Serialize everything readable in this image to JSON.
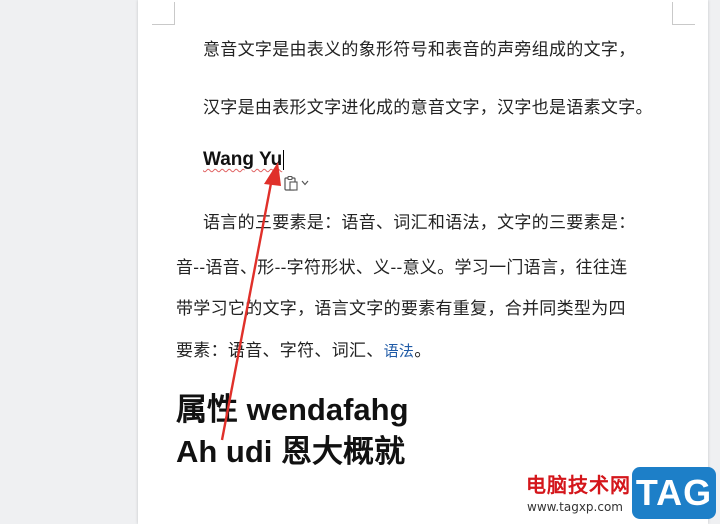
{
  "document": {
    "line1": "意音文字是由表义的象形符号和表音的声旁组成的文字，",
    "line2": "汉字是由表形文字进化成的意音文字，汉字也是语素文字。",
    "heading": "Wang Yu",
    "para": [
      "语言的三要素是：语音、词汇和语法，文字的三要素是：",
      "音--语音、形--字符形状、义--意义。学习一门语言，往往连",
      "带学习它的文字，语言文字的要素有重复，合并同类型为四",
      "要素：语音、字符、词汇、"
    ],
    "para_link": "语法",
    "para_end": "。",
    "big1": "属性 wendafahg",
    "big2": "Ah udi 恩大概就"
  },
  "paste_options": {
    "icon": "clipboard-icon",
    "dropdown": "chevron-down-icon"
  },
  "annotation": {
    "color": "#e0302a"
  },
  "watermark": {
    "text": "电脑技术网",
    "url": "www.tagxp.com",
    "logo": "TAG"
  }
}
